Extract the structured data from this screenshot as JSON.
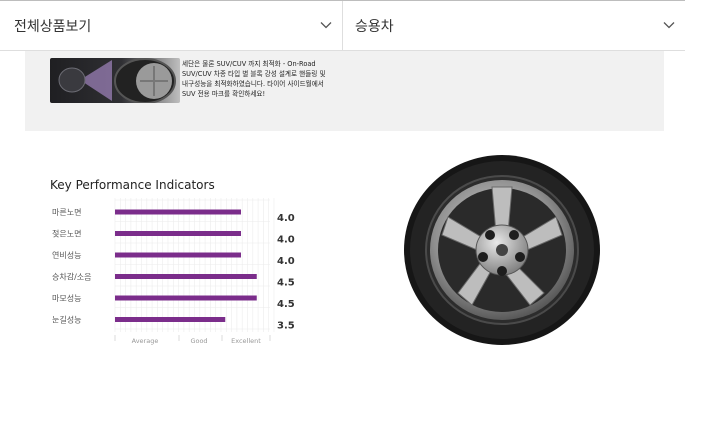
{
  "dropdowns": [
    {
      "value": "전체상품보기"
    },
    {
      "value": "승용차"
    }
  ],
  "info_text": "세단은 물론 SUV/CUV 까지 최적화 - On-Road SUV/CUV 차종 타입 별 블록 강성 설계로 핸들링 및 내구성능을 최적화하였습니다. 타이어 사이드월에서 SUV 전용 마크를 확인하세요!",
  "kpi": {
    "title": "Key Performance Indicators"
  },
  "chart_data": {
    "type": "bar",
    "orientation": "horizontal",
    "title": "Key Performance Indicators",
    "categories": [
      "마른노면",
      "젖은노면",
      "연비성능",
      "승차감/소음",
      "마모성능",
      "눈길성능"
    ],
    "values": [
      4.0,
      4.0,
      4.0,
      4.5,
      4.5,
      3.5
    ],
    "value_labels": [
      "4.0",
      "4.0",
      "4.0",
      "4.5",
      "4.5",
      "3.5"
    ],
    "x_ticks": [
      "Average",
      "Good",
      "Excellent"
    ],
    "xlim": [
      0,
      5
    ],
    "bar_color": "#7b2d8b",
    "grid": true
  },
  "colors": {
    "accent": "#7b2d8b",
    "panel": "#f1f1f1"
  }
}
